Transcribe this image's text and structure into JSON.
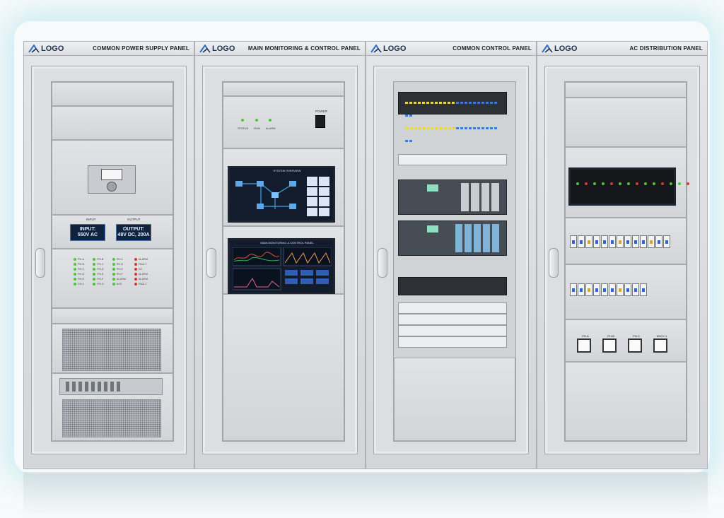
{
  "panels": [
    {
      "logo": "LOGO",
      "title": "COMMON POWER SUPPLY PANEL"
    },
    {
      "logo": "LOGO",
      "title": "MAIN MONITORING & CONTROL PANEL"
    },
    {
      "logo": "LOGO",
      "title": "COMMON CONTROL PANEL"
    },
    {
      "logo": "LOGO",
      "title": "AC DISTRIBUTION PANEL"
    }
  ],
  "power_supply": {
    "input_label": "INPUT",
    "output_label": "OUTPUT",
    "input_display": [
      "INPUT:",
      "550V AC"
    ],
    "output_display": [
      "OUTPUT:",
      "48V DC, 200A"
    ],
    "status_columns": [
      [
        "PH-A",
        "PH-B",
        "PH-C",
        "PH-D",
        "PH-E",
        "CH-1"
      ],
      [
        "PH-B",
        "PH-C",
        "PH-D",
        "PH-E",
        "PH-F",
        "PH-G"
      ],
      [
        "PH-C",
        "PH-D",
        "PH-E",
        "PH-F",
        "ALARM",
        "ACK"
      ],
      [
        "ALARM",
        "FAULT",
        "DC",
        "ALARM",
        "ALARM",
        "FAULT"
      ]
    ],
    "led_colors": [
      "#52c23a",
      "#52c23a",
      "#52c23a",
      "#d33b2b"
    ]
  },
  "monitoring": {
    "indicator_labels": [
      "STATUS",
      "RUN",
      "ALARM"
    ],
    "switch_label": "POWER",
    "screen1_title": "SYSTEM OVERVIEW",
    "screen2_title": "MAIN MONITORING & CONTROL PANEL"
  },
  "ac_distribution": {
    "meter_labels": [
      "PH-A",
      "PH-B",
      "PH-C",
      "ENGY-1"
    ]
  },
  "colors": {
    "cabinet": "#d8dbde",
    "screen": "#131c2c",
    "led_green": "#52c23a",
    "led_red": "#d33b2b",
    "breaker_blue": "#2c66c8",
    "brand": "#1d2f4e"
  },
  "icons": [
    "logo-triangle-icon",
    "door-handle-icon"
  ]
}
